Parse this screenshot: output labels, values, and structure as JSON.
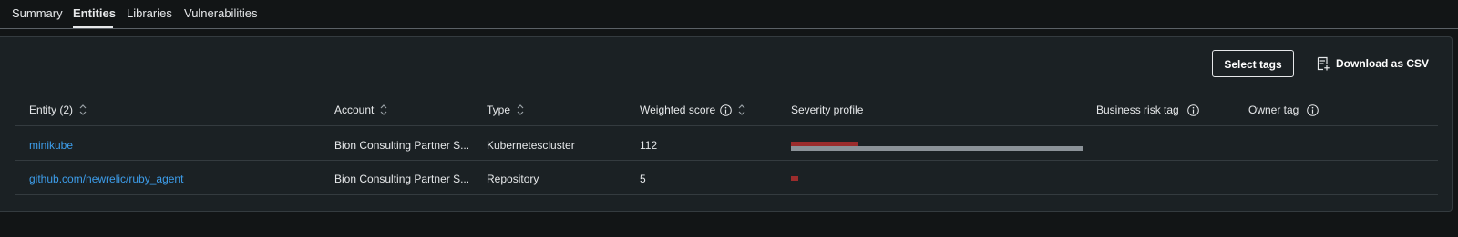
{
  "tabs": [
    {
      "label": "Summary",
      "active": false
    },
    {
      "label": "Entities",
      "active": true
    },
    {
      "label": "Libraries",
      "active": false
    },
    {
      "label": "Vulnerabilities",
      "active": false
    }
  ],
  "toolbar": {
    "select_tags_label": "Select tags",
    "download_csv_label": "Download as CSV",
    "download_icon": "document-add-icon"
  },
  "table": {
    "headers": {
      "entity": "Entity (2)",
      "account": "Account",
      "type": "Type",
      "weighted_score": "Weighted score",
      "severity_profile": "Severity profile",
      "business_risk_tag": "Business risk tag",
      "owner_tag": "Owner tag"
    },
    "rows": [
      {
        "entity": "minikube",
        "account": "Bion Consulting Partner S...",
        "type": "Kubernetescluster",
        "weighted_score": "112",
        "severity_profile": {
          "critical_fraction": 0.23,
          "other_fraction": 1.0
        }
      },
      {
        "entity": "github.com/newrelic/ruby_agent",
        "account": "Bion Consulting Partner S...",
        "type": "Repository",
        "weighted_score": "5",
        "severity_profile": {
          "critical_fraction": 0.025,
          "other_fraction": 0
        }
      }
    ]
  },
  "colors": {
    "link": "#3d9dea",
    "severity_critical": "#9b2c2c",
    "severity_other": "#8b9298"
  }
}
